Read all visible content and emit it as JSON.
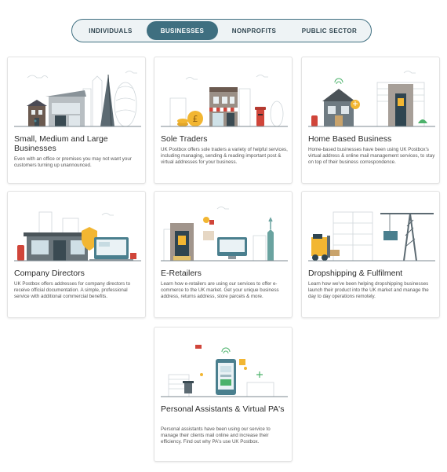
{
  "tabs": [
    {
      "label": "INDIVIDUALS"
    },
    {
      "label": "BUSINESSES",
      "active": true
    },
    {
      "label": "NONPROFITS"
    },
    {
      "label": "PUBLIC SECTOR"
    }
  ],
  "cards": [
    {
      "title": "Small, Medium and Large Businesses",
      "description": "Even with an office or premises you may not want your customers turning up unannounced."
    },
    {
      "title": "Sole Traders",
      "description": "UK Postbox offers sole traders a variety of helpful services, including managing, sending & reading important post & virtual addresses for your business."
    },
    {
      "title": "Home Based Business",
      "description": "Home-based businesses have been using UK Postbox's virtual address & online mail management services, to stay on top of their business correspondence."
    },
    {
      "title": "Company Directors",
      "description": "UK Postbox offers addresses for company directors to receive official documentation. A simple, professional service with additional commercial benefits."
    },
    {
      "title": "E-Retailers",
      "description": "Learn how e-retailers are using our services to offer e-commerce to the UK market. Get your unique business address, returns address, store parcels & more."
    },
    {
      "title": "Dropshipping & Fulfilment",
      "description": "Learn how we've been helping dropshipping businesses launch their product into the UK market and manage the day to day operations remotely."
    },
    {
      "title": "Personal Assistants & Virtual PA's",
      "description": "Personal assistants have been using our service to manage their clients mail online and increase their efficiency. Find out why PA's use UK Postbox."
    }
  ],
  "colors": {
    "accent": "#3f6f80",
    "red": "#d0453a",
    "yellow": "#f2b632",
    "teal": "#4c8a97"
  }
}
